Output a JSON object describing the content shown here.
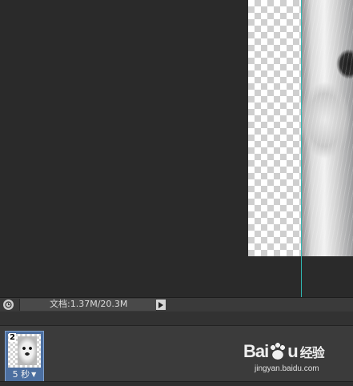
{
  "status_bar": {
    "doc_info": "文档:1.37M/20.3M"
  },
  "timeline": {
    "frames": [
      {
        "number": "2",
        "delay": "5 秒"
      }
    ]
  },
  "watermark": {
    "url": "jingyan.baidu.com"
  },
  "colors": {
    "guide_line": "#2fb7b2",
    "frame_selected": "#4c6fa0",
    "workspace": "#2a2a2a"
  }
}
